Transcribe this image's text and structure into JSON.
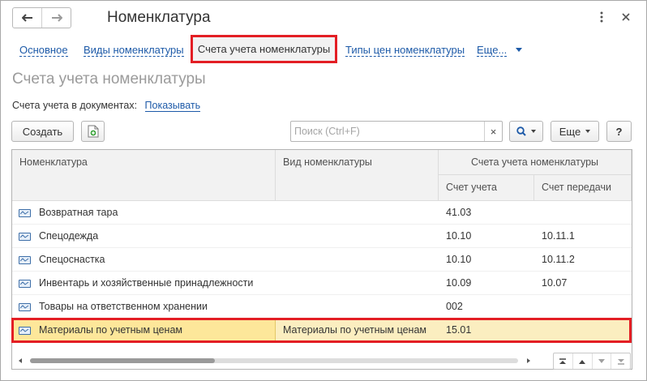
{
  "window": {
    "title": "Номенклатура"
  },
  "header": {
    "back_icon": "arrow-left-icon",
    "forward_icon": "arrow-right-icon",
    "menu_icon": "more-vertical-icon",
    "close_icon": "close-icon"
  },
  "tabs": [
    {
      "label": "Основное"
    },
    {
      "label": "Виды номенклатуры"
    },
    {
      "label": "Счета учета номенклатуры",
      "active": true
    },
    {
      "label": "Типы цен номенклатуры"
    },
    {
      "label": "Еще..."
    }
  ],
  "page": {
    "title": "Счета учета номенклатуры",
    "docs_label": "Счета учета в документах:",
    "docs_link": "Показывать"
  },
  "toolbar": {
    "create_label": "Создать",
    "search_placeholder": "Поиск (Ctrl+F)",
    "clear_glyph": "×",
    "more_label": "Еще",
    "help_label": "?"
  },
  "table": {
    "columns": {
      "nomenclature": "Номенклатура",
      "kind": "Вид номенклатуры",
      "group": "Счета учета номенклатуры",
      "account": "Счет учета",
      "transfer": "Счет передачи"
    },
    "rows": [
      {
        "name": "Возвратная тара",
        "kind": "",
        "account": "41.03",
        "transfer": ""
      },
      {
        "name": "Спецодежда",
        "kind": "",
        "account": "10.10",
        "transfer": "10.11.1"
      },
      {
        "name": "Спецоснастка",
        "kind": "",
        "account": "10.10",
        "transfer": "10.11.2"
      },
      {
        "name": "Инвентарь и хозяйственные принадлежности",
        "kind": "",
        "account": "10.09",
        "transfer": "10.07"
      },
      {
        "name": "Товары на ответственном хранении",
        "kind": "",
        "account": "002",
        "transfer": ""
      },
      {
        "name": "Материалы по учетным ценам",
        "kind": "Материалы по учетным ценам",
        "account": "15.01",
        "transfer": "",
        "selected": true
      }
    ]
  },
  "colors": {
    "link": "#1d5aa8",
    "highlight": "#e31e24",
    "selected_row": "#fbeec0",
    "selected_cell": "#fde79a"
  }
}
